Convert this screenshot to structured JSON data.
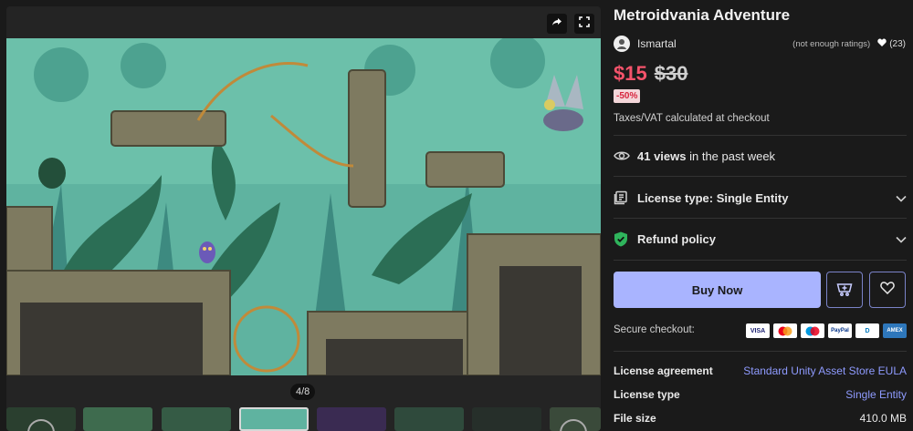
{
  "media": {
    "counter": "4/8",
    "share_icon": "share-icon",
    "fullscreen_icon": "fullscreen-icon"
  },
  "product": {
    "title": "Metroidvania Adventure",
    "author": "Ismartal",
    "ratings_text": "(not enough ratings)",
    "favorites": "(23)",
    "price_now": "$15",
    "price_old": "$30",
    "discount": "-50%",
    "taxes": "Taxes/VAT calculated at checkout"
  },
  "views": {
    "count": "41 views",
    "suffix": " in the past week"
  },
  "license_type": {
    "label": "License type: Single Entity"
  },
  "refund": {
    "label": "Refund policy"
  },
  "actions": {
    "buy_label": "Buy Now"
  },
  "checkout": {
    "secure_label": "Secure checkout:",
    "cards": [
      "VISA",
      "MC",
      "MC",
      "PayPal",
      "D",
      "AMEX"
    ]
  },
  "info": [
    {
      "key": "License agreement",
      "value": "Standard Unity Asset Store EULA"
    },
    {
      "key": "License type",
      "value": "Single Entity"
    },
    {
      "key": "File size",
      "value": "410.0 MB"
    }
  ],
  "colors": {
    "accent": "#a9b4ff",
    "price": "#f4536b",
    "link": "#8f9bff",
    "refund_green": "#2fb45c"
  }
}
